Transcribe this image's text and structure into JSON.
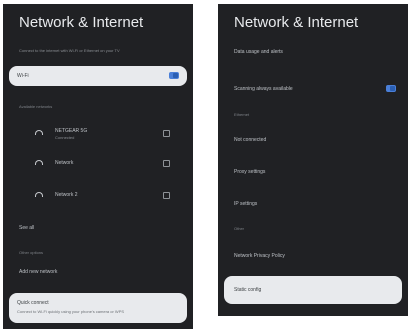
{
  "left": {
    "title": "Network & Internet",
    "description": "Connect to the internet with Wi-Fi or Ethernet on your TV",
    "wifi_label": "Wi-Fi",
    "wifi_toggle_on": true,
    "available_header": "Available networks",
    "networks": [
      {
        "name": "NETGEAR 5G",
        "sub": "Connected",
        "secure": true
      },
      {
        "name": "Network",
        "sub": "",
        "secure": true
      },
      {
        "name": "Network 2",
        "sub": "",
        "secure": true
      }
    ],
    "see_all": "See all",
    "other_header": "Other options",
    "add_network": "Add new network",
    "quick_connect_title": "Quick connect",
    "quick_connect_sub": "Connect to Wi-Fi quickly using your phone's camera or WPS"
  },
  "right": {
    "title": "Network & Internet",
    "data_usage": "Data usage and alerts",
    "scanning_label": "Scanning always available",
    "scanning_toggle_on": true,
    "ethernet_header": "Ethernet",
    "not_connected": "Not connected",
    "proxy": "Proxy settings",
    "ip": "IP settings",
    "other_header": "Other",
    "privacy": "Network Privacy Policy",
    "config": "Static config"
  },
  "colors": {
    "panel_bg": "#202124",
    "accent": "#4a7fd8",
    "highlight": "#e8eaed"
  }
}
